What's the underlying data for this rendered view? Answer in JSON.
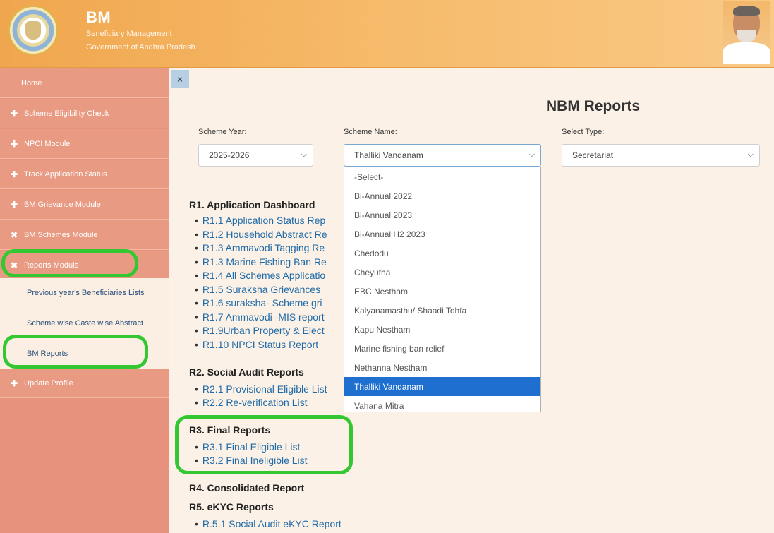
{
  "header": {
    "title": "BM",
    "subtitle1": "Beneficiary Management",
    "subtitle2": "Government of Andhra Pradesh"
  },
  "sidebar": {
    "items": [
      {
        "label": "Home",
        "icon": ""
      },
      {
        "label": "Scheme Eligibility Check",
        "icon": "plus-icon"
      },
      {
        "label": "NPCI Module",
        "icon": "plus-icon"
      },
      {
        "label": "Track Application Status",
        "icon": "plus-icon"
      },
      {
        "label": "BM Grievance Module",
        "icon": "plus-icon"
      },
      {
        "label": "BM Schemes Module",
        "icon": "close-icon"
      },
      {
        "label": "Reports Module",
        "icon": "close-icon"
      },
      {
        "label": "Update Profile",
        "icon": "plus-icon"
      }
    ],
    "submenu": [
      {
        "label": "Previous year's Beneficiaries Lists"
      },
      {
        "label": "Scheme wise Caste wise Abstract"
      },
      {
        "label": "BM Reports"
      }
    ]
  },
  "main": {
    "close_label": "×",
    "page_title": "NBM Reports",
    "filters": {
      "year_label": "Scheme Year:",
      "year_value": "2025-2026",
      "name_label": "Scheme Name:",
      "name_value": "Thalliki Vandanam",
      "type_label": "Select Type:",
      "type_value": "Secretariat"
    },
    "dropdown_options": [
      "-Select-",
      "Bi-Annual 2022",
      "Bi-Annual 2023",
      "Bi-Annual H2 2023",
      "Chedodu",
      "Cheyutha",
      "EBC Nestham",
      "Kalyanamasthu/ Shaadi Tohfa",
      "Kapu Nestham",
      "Marine fishing ban relief",
      "Nethanna Nestham",
      "Thalliki Vandanam",
      "Vahana Mitra"
    ],
    "selected_option": "Thalliki Vandanam",
    "sections": {
      "r1": {
        "title": "R1. Application Dashboard",
        "links": [
          "R1.1 Application Status Rep",
          "R1.2 Household Abstract Re",
          "R1.3 Ammavodi Tagging Re",
          "R1.3 Marine Fishing Ban Re",
          "R1.4 All Schemes Applicatio",
          "R1.5 Suraksha Grievances",
          "R1.6 suraksha- Scheme gri",
          "R1.7 Ammavodi -MIS report",
          "R1.9Urban Property & Elect",
          "R1.10 NPCI Status Report"
        ]
      },
      "r2": {
        "title": "R2. Social Audit Reports",
        "links": [
          "R2.1 Provisional Eligible List",
          "R2.2 Re-verification List"
        ]
      },
      "r3": {
        "title": "R3. Final Reports",
        "links": [
          "R3.1 Final Eligible List",
          "R3.2 Final Ineligible List"
        ]
      },
      "r4": {
        "title": "R4. Consolidated Report"
      },
      "r5": {
        "title": "R5. eKYC Reports",
        "links": [
          "R.5.1 Social Audit eKYC Report"
        ]
      }
    }
  },
  "colors": {
    "header": "#f4b25e",
    "sidebar": "#e89a82",
    "highlight": "#33c832",
    "selected": "#1e6fd0",
    "link": "#1f6aa8"
  }
}
